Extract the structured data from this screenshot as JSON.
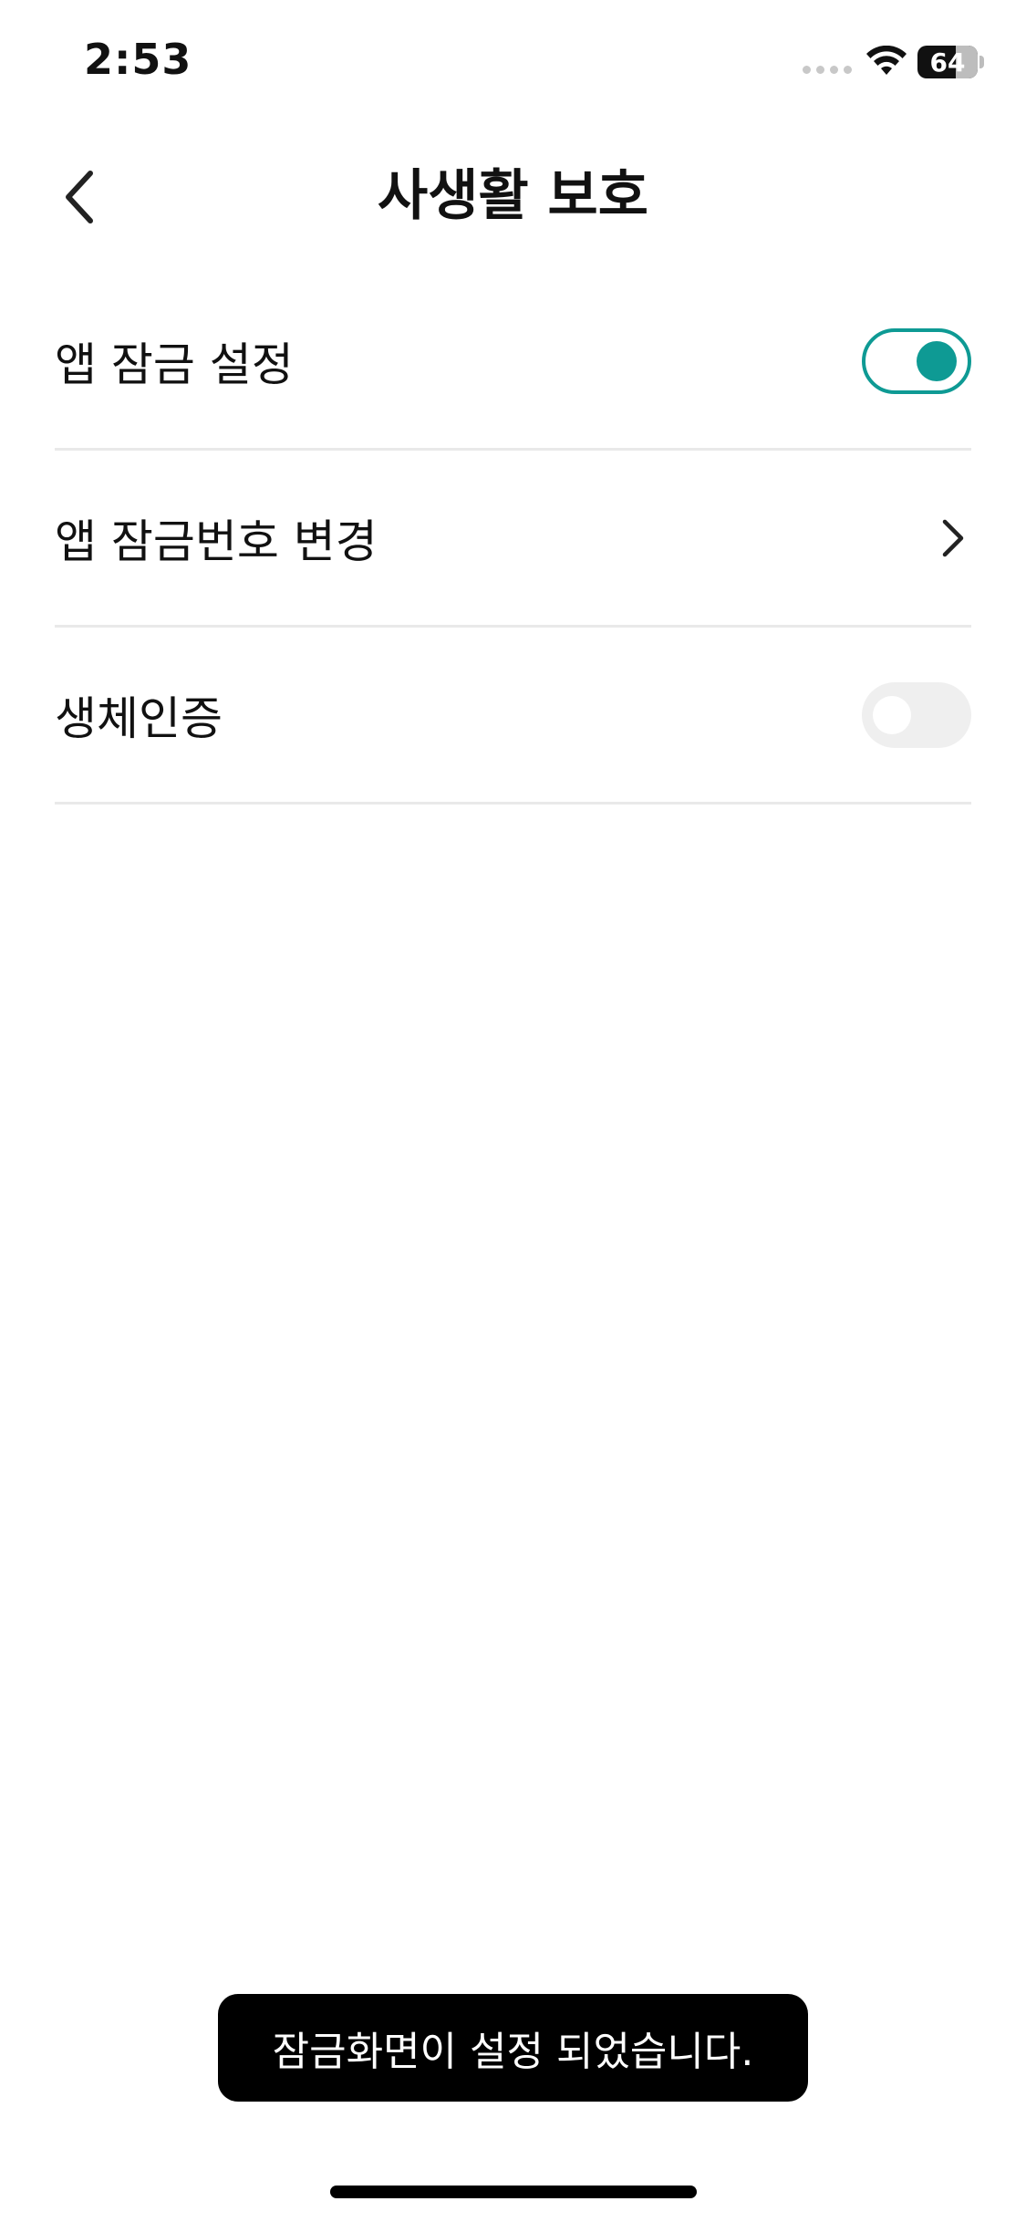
{
  "status_bar": {
    "time": "2:53",
    "battery_level": "64",
    "signal_icon": "cellular-signal-dots-icon",
    "wifi_icon": "wifi-icon",
    "battery_icon": "battery-icon"
  },
  "header": {
    "title": "사생활 보호",
    "back_icon": "chevron-left-icon"
  },
  "settings": {
    "items": [
      {
        "label": "앱 잠금 설정",
        "control": "toggle",
        "state": "on"
      },
      {
        "label": "앱 잠금번호 변경",
        "control": "chevron",
        "icon": "chevron-right-icon"
      },
      {
        "label": "생체인증",
        "control": "toggle",
        "state": "off"
      }
    ]
  },
  "toast": {
    "message": "잠금화면이 설정 되었습니다."
  },
  "colors": {
    "accent": "#0e9a94",
    "toggle_off_track": "#efefef",
    "divider": "#e9e9e9",
    "toast_bg": "#000000",
    "text": "#111111"
  }
}
